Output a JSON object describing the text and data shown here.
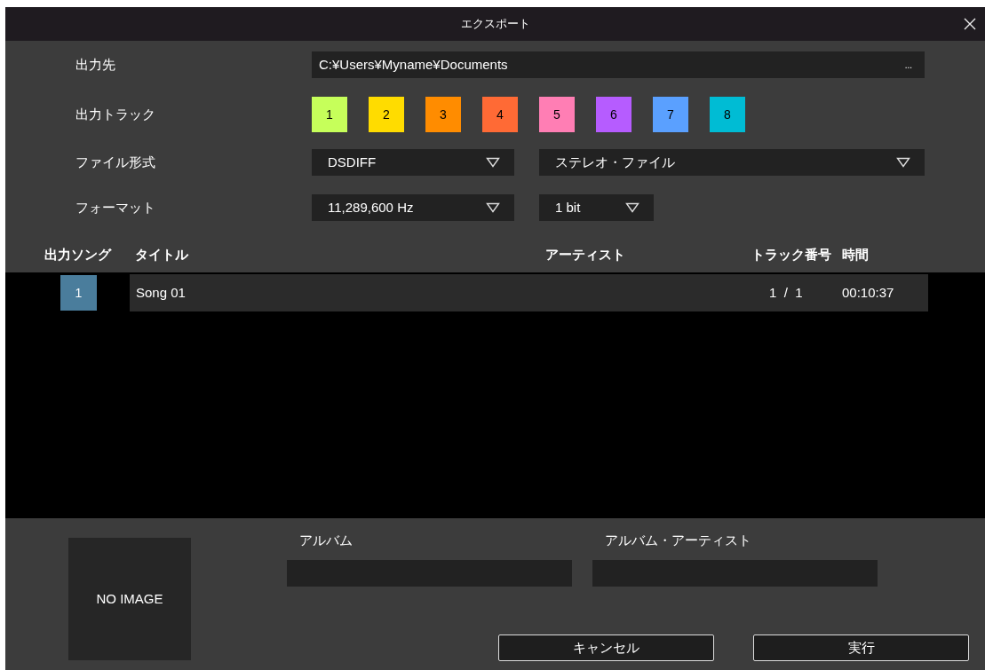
{
  "window": {
    "title": "エクスポート"
  },
  "destination": {
    "label": "出力先",
    "value": "C:¥Users¥Myname¥Documents",
    "browse": "..."
  },
  "output_tracks": {
    "label": "出力トラック",
    "tracks": [
      {
        "label": "1",
        "color": "#c6ff5a"
      },
      {
        "label": "2",
        "color": "#ffdc00"
      },
      {
        "label": "3",
        "color": "#ff8c00"
      },
      {
        "label": "4",
        "color": "#ff6a35"
      },
      {
        "label": "5",
        "color": "#ff7eb4"
      },
      {
        "label": "6",
        "color": "#b65cff"
      },
      {
        "label": "7",
        "color": "#5aa0ff"
      },
      {
        "label": "8",
        "color": "#00bcd4"
      }
    ]
  },
  "file_type": {
    "label": "ファイル形式",
    "type": "DSDIFF",
    "channels": "ステレオ・ファイル"
  },
  "format": {
    "label": "フォーマット",
    "rate": "11,289,600 Hz",
    "bits": "1 bit"
  },
  "table": {
    "columns": [
      "出力ソング",
      "タイトル",
      "アーティスト",
      "トラック番号",
      "時間"
    ],
    "rows": [
      {
        "number": "1",
        "checked": true,
        "title": "Song 01",
        "track": "1  /  1",
        "time": "00:10:37"
      }
    ]
  },
  "artwork": {
    "text": "NO IMAGE"
  },
  "album": {
    "label": "アルバム"
  },
  "album_artist": {
    "label": "アルバム・アーティスト"
  },
  "buttons": [
    "キャンセル",
    "実行"
  ]
}
